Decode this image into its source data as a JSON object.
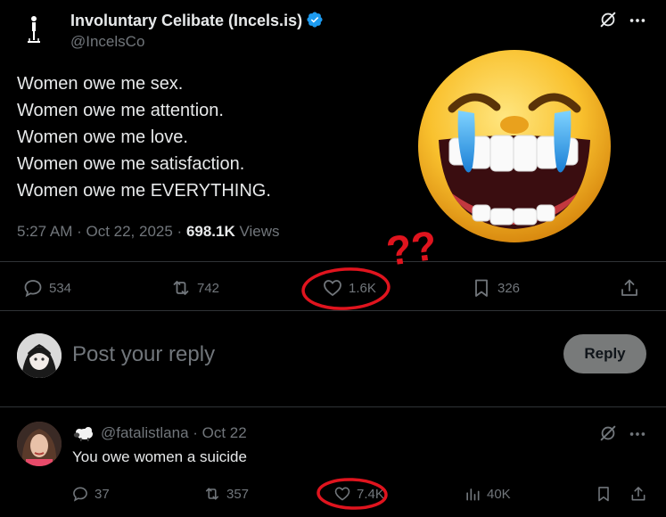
{
  "tweet": {
    "author_name": "Involuntary Celibate (Incels.is)",
    "author_handle": "@IncelsCo",
    "lines": [
      "Women owe me sex.",
      "Women owe me attention.",
      "Women owe me love.",
      "Women owe me satisfaction.",
      "Women owe me EVERYTHING."
    ],
    "timestamp": "5:27 AM · Oct 22, 2025 · ",
    "views_count": "698.1K",
    "views_label": " Views",
    "actions": {
      "replies": "534",
      "reposts": "742",
      "likes": "1.6K",
      "bookmarks": "326"
    }
  },
  "composer": {
    "placeholder": "Post your reply",
    "reply_label": "Reply"
  },
  "comment": {
    "handle": "@fatalistlana",
    "date": " · Oct 22",
    "text": "You owe women a suicide",
    "actions": {
      "replies": "37",
      "reposts": "357",
      "likes": "7.4K",
      "views": "40K"
    }
  },
  "annotation": {
    "question_marks": "??"
  },
  "colors": {
    "background": "#000000",
    "text": "#e7e9ea",
    "muted": "#71767b",
    "divider": "#2f3336",
    "verified": "#1d9bf0",
    "annotation_red": "#e0141e"
  }
}
